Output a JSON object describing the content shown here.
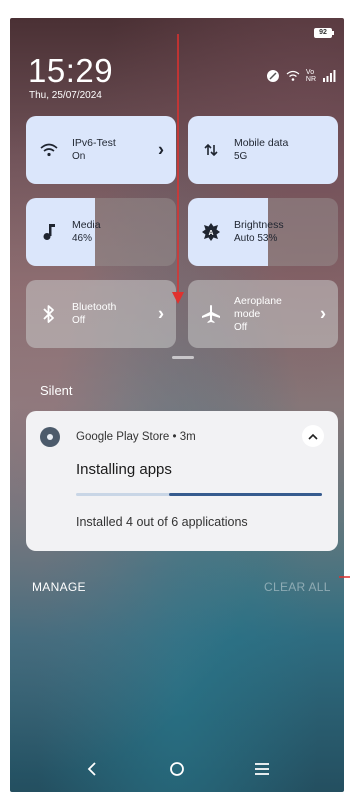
{
  "status_bar": {
    "battery": "92",
    "time": "15:29",
    "date": "Thu, 25/07/2024",
    "network_label_top": "Vo",
    "network_label_bottom": "NR"
  },
  "tiles": {
    "wifi": {
      "title": "IPv6-Test",
      "subtitle": "On",
      "icon": "wifi-icon"
    },
    "mobile_data": {
      "title": "Mobile data",
      "subtitle": "5G",
      "icon": "data-arrows-icon"
    },
    "media": {
      "title": "Media",
      "subtitle": "46%",
      "icon": "music-note-icon",
      "level": 0.46
    },
    "brightness": {
      "title": "Brightness",
      "subtitle": "Auto 53%",
      "icon": "brightness-icon",
      "level": 0.53
    },
    "bluetooth": {
      "title": "Bluetooth",
      "subtitle": "Off",
      "icon": "bluetooth-icon"
    },
    "aeroplane": {
      "title_line1": "Aeroplane",
      "title_line2": "mode",
      "subtitle": "Off",
      "icon": "airplane-icon"
    }
  },
  "section": {
    "label": "Silent"
  },
  "notification": {
    "app_name": "Google Play Store • 3m",
    "title": "Installing apps",
    "text": "Installed 4 out of 6 applications",
    "progress": 0.62
  },
  "actions": {
    "manage": "MANAGE",
    "clear_all": "CLEAR ALL"
  },
  "colors": {
    "tile_active": "#dbe6fb",
    "progress_fill": "#365b8e",
    "annotation": "#e0312e"
  }
}
